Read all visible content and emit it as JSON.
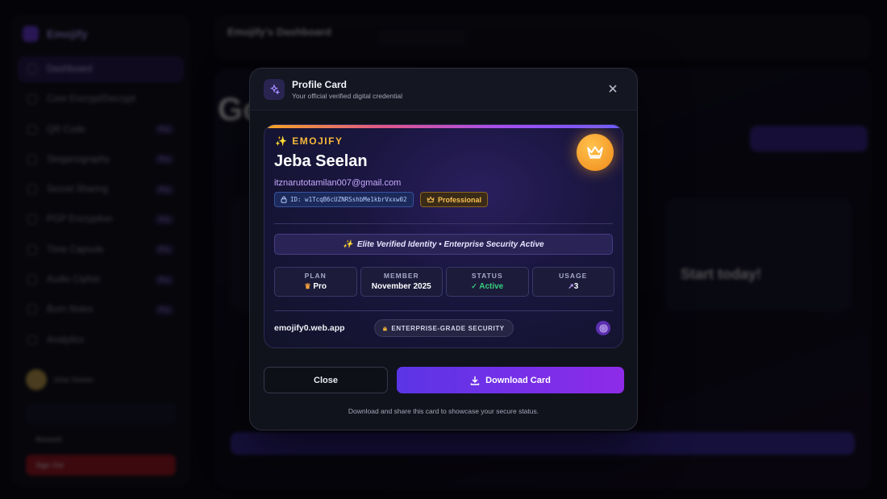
{
  "background_app": {
    "brand": "Emojify",
    "sidebar": {
      "items": [
        {
          "label": "Dashboard",
          "pro": ""
        },
        {
          "label": "Core Encrypt/Decrypt",
          "pro": ""
        },
        {
          "label": "QR Code",
          "pro": "Pro"
        },
        {
          "label": "Steganography",
          "pro": "Pro"
        },
        {
          "label": "Secret Sharing",
          "pro": "Pro"
        },
        {
          "label": "PGP Encryption",
          "pro": "Pro"
        },
        {
          "label": "Time Capsule",
          "pro": "Pro"
        },
        {
          "label": "Audio Cipher",
          "pro": "Pro"
        },
        {
          "label": "Burn Notes",
          "pro": "Pro"
        },
        {
          "label": "Analytics",
          "pro": ""
        }
      ],
      "user_name": "Jeba Seelan",
      "account": "Account",
      "sign_out": "Sign Out"
    },
    "topbar": {
      "title": "Emojify's Dashboard"
    },
    "main": {
      "greeting": "Go",
      "streak_title": "Start today!"
    }
  },
  "modal": {
    "title": "Profile Card",
    "subtitle": "Your official verified digital credential",
    "card": {
      "brand": "✨ EMOJIFY",
      "name": "Jeba Seelan",
      "email": "itznarutotamilan007@gmail.com",
      "id_text": "ID: w1TcqB6cUZNRSshbMe1kbrVxxw02",
      "tier": "Professional",
      "elite_text": "Elite Verified Identity • Enterprise Security Active",
      "stats": [
        {
          "label": "PLAN",
          "value": "Pro"
        },
        {
          "label": "MEMBER",
          "value": "November 2025"
        },
        {
          "label": "STATUS",
          "value": "Active"
        },
        {
          "label": "USAGE",
          "value": "3"
        }
      ],
      "domain": "emojify0.web.app",
      "security": "ENTERPRISE-GRADE SECURITY"
    },
    "close_label": "Close",
    "download_label": "Download Card",
    "hint": "Download and share this card to showcase your secure status."
  },
  "colors": {
    "accent": "#7c3aed",
    "gold": "#f6b83a",
    "active_green": "#35d07f"
  }
}
